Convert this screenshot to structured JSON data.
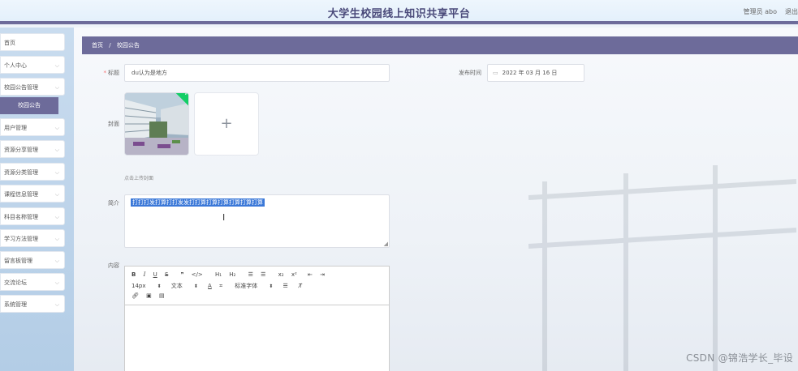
{
  "header": {
    "title": "大学生校园线上知识共享平台",
    "user": "管理员 abo",
    "logout": "退出"
  },
  "sidebar": {
    "items": [
      {
        "label": "首页",
        "has_chevron": false
      },
      {
        "label": "个人中心",
        "has_chevron": true
      },
      {
        "label": "校园公告管理",
        "has_chevron": true
      },
      {
        "label": "用户管理",
        "has_chevron": true
      },
      {
        "label": "资源分享管理",
        "has_chevron": true
      },
      {
        "label": "资源分类管理",
        "has_chevron": true
      },
      {
        "label": "课程信息管理",
        "has_chevron": true
      },
      {
        "label": "科目名称管理",
        "has_chevron": true
      },
      {
        "label": "学习方法管理",
        "has_chevron": true
      },
      {
        "label": "留言板管理",
        "has_chevron": true
      },
      {
        "label": "交流论坛",
        "has_chevron": true
      },
      {
        "label": "系统管理",
        "has_chevron": true
      }
    ],
    "active_sub": "校园公告"
  },
  "breadcrumb": {
    "home": "首页",
    "separator": "/",
    "current": "校园公告"
  },
  "form": {
    "title_label": "标题",
    "title_value": "du认为是地方",
    "time_label": "发布时间",
    "time_value": "2022 年 03 月 16 日",
    "cover_label": "封面",
    "cover_hint": "点击上传封面",
    "summary_label": "简介",
    "summary_value": "打打打发打算打打发发打打算打算打算打算打算打算",
    "content_label": "内容"
  },
  "editor": {
    "font_size": "14px",
    "paragraph": "文本",
    "font_family": "标准字体"
  },
  "watermark": "CSDN @锦浩学长_毕设",
  "colors": {
    "accent": "#6d6b9a",
    "selection": "#3b78d8",
    "success": "#13ce66",
    "sidebar_bg": "#c9dcef"
  }
}
